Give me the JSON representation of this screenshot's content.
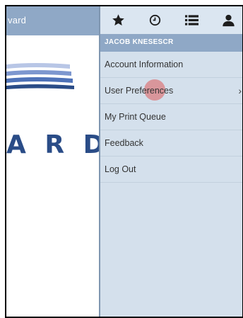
{
  "left_app": {
    "header_text": "vard",
    "logo_text": "A R D",
    "logo_mark": "®"
  },
  "toolbar": {
    "icons": [
      "star-icon",
      "clock-icon",
      "list-icon",
      "user-icon"
    ]
  },
  "user": {
    "name": "JACOB KNESESCR"
  },
  "menu": {
    "items": [
      {
        "label": "Account Information"
      },
      {
        "label": "User Preferences",
        "has_submenu": true
      },
      {
        "label": "My Print Queue"
      },
      {
        "label": "Feedback"
      },
      {
        "label": "Log Out"
      }
    ]
  },
  "colors": {
    "header_blue": "#8fa8c6",
    "menu_bg": "#d4e0ec",
    "logo_blue": "#2a4c87",
    "touch_indicator": "#dc5a5a"
  }
}
